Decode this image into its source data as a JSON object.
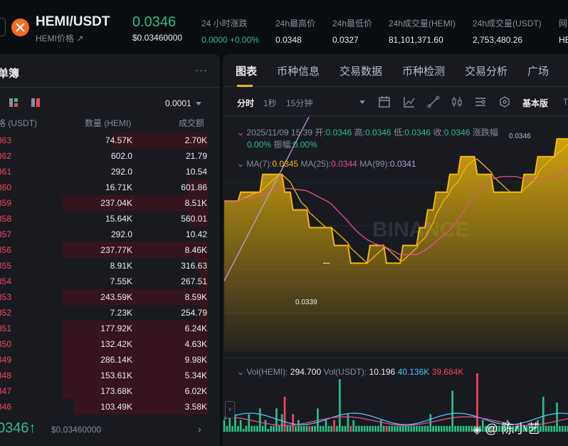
{
  "header": {
    "pair": "HEMI/USDT",
    "pair_sub": "HEMI价格 ↗",
    "last_price": "0.0346",
    "last_price_usd": "$0.03460000",
    "stats": [
      {
        "label": "24 小时涨跌",
        "value": "0.0000 +0.00%",
        "color": "green"
      },
      {
        "label": "24h最高价",
        "value": "0.0348"
      },
      {
        "label": "24h最低价",
        "value": "0.0327"
      },
      {
        "label": "24h成交量(HEMI)",
        "value": "81,101,371.60"
      },
      {
        "label": "24h成交量(USDT)",
        "value": "2,753,480.26"
      },
      {
        "label": "网",
        "value": "HE"
      }
    ]
  },
  "orderbook": {
    "title": "单簿",
    "more": "···",
    "precision": "0.0001",
    "col_price": "格 (USDT)",
    "col_qty": "数量 (HEMI)",
    "col_total": "成交额",
    "asks": [
      {
        "price": "363",
        "qty": "74.57K",
        "total": "2.70K",
        "depth": 0.66
      },
      {
        "price": "362",
        "qty": "602.0",
        "total": "21.79",
        "depth": 0
      },
      {
        "price": "361",
        "qty": "292.0",
        "total": "10.54",
        "depth": 0
      },
      {
        "price": "360",
        "qty": "16.71K",
        "total": "601.86",
        "depth": 0.14
      },
      {
        "price": "359",
        "qty": "237.04K",
        "total": "8.51K",
        "depth": 1.0
      },
      {
        "price": "358",
        "qty": "15.64K",
        "total": "560.01",
        "depth": 0.13
      },
      {
        "price": "357",
        "qty": "292.0",
        "total": "10.42",
        "depth": 0
      },
      {
        "price": "356",
        "qty": "237.77K",
        "total": "8.46K",
        "depth": 1.0
      },
      {
        "price": "355",
        "qty": "8.91K",
        "total": "316.63",
        "depth": 0.07
      },
      {
        "price": "354",
        "qty": "7.55K",
        "total": "267.51",
        "depth": 0.06
      },
      {
        "price": "353",
        "qty": "243.59K",
        "total": "8.59K",
        "depth": 1.0
      },
      {
        "price": "352",
        "qty": "7.23K",
        "total": "254.79",
        "depth": 0.06
      },
      {
        "price": "351",
        "qty": "177.92K",
        "total": "6.24K",
        "depth": 1.0
      },
      {
        "price": "350",
        "qty": "132.42K",
        "total": "4.63K",
        "depth": 1.0
      },
      {
        "price": "349",
        "qty": "286.14K",
        "total": "9.98K",
        "depth": 1.0
      },
      {
        "price": "348",
        "qty": "153.61K",
        "total": "5.34K",
        "depth": 1.0
      },
      {
        "price": "347",
        "qty": "173.68K",
        "total": "6.02K",
        "depth": 1.0
      },
      {
        "price": "346",
        "qty": "103.49K",
        "total": "3.58K",
        "depth": 0.92
      }
    ],
    "last_price": "0346↑",
    "last_price_usd": "$0.03460000",
    "chevron": "›"
  },
  "tabs": [
    "图表",
    "币种信息",
    "交易数据",
    "币种检测",
    "交易分析",
    "广场"
  ],
  "toolbar": {
    "intervals": [
      "分时",
      "1秒",
      "15分钟"
    ],
    "version": "基本版",
    "cut": "T"
  },
  "chart_info": {
    "ohlc_prefix": "2025/11/09 15:39",
    "open_label": "开:",
    "open": "0.0346",
    "high_label": "高:",
    "high": "0.0346",
    "low_label": "低:",
    "low": "0.0346",
    "close_label": "收:",
    "close": "0.0346",
    "change_label": "涨跌幅",
    "change": "0.00%",
    "amp_label": "振幅:",
    "amp": "0.00%",
    "ma7_label": "MA(7):",
    "ma7": "0.0345",
    "ma25_label": "MA(25):",
    "ma25": "0.0344",
    "ma99_label": "MA(99):",
    "ma99": "0.0341",
    "price_high_label": "0.0346",
    "price_low_label": "0.0339",
    "vol_hemi_label": "Vol(HEMI):",
    "vol_hemi": "294.700",
    "vol_usdt_label": "Vol(USDT):",
    "vol_usdt": "10.196",
    "vol_ma1": "40.136K",
    "vol_ma2": "39.684K",
    "watermark_brand": "BINANCE",
    "colors": {
      "up": "#2ebd85",
      "down": "#f6465d",
      "area": "#f0b90b",
      "ma25": "#e2528c",
      "ma99": "#b39ddb"
    }
  },
  "chart_data": {
    "type": "area",
    "series": [
      {
        "values": [
          0.03425,
          0.03425,
          0.03425,
          0.03425,
          0.03425,
          0.03425,
          0.0343,
          0.0343,
          0.0343,
          0.0343,
          0.0343,
          0.0343,
          0.0343,
          0.0343,
          0.0344,
          0.0344,
          0.0344,
          0.0344,
          0.0344,
          0.0344,
          0.0344,
          0.0344,
          0.0343,
          0.0343,
          0.0343,
          0.0342,
          0.0342,
          0.0342,
          0.0342,
          0.0342,
          0.0342,
          0.0341,
          0.0341,
          0.0341,
          0.0341,
          0.0341,
          0.0341,
          0.0341,
          0.0341,
          0.0341,
          0.034,
          0.034,
          0.034,
          0.034,
          0.034,
          0.034,
          0.0339,
          0.0339,
          0.0339,
          0.0339,
          0.0339,
          0.0339,
          0.0339,
          0.034,
          0.034,
          0.034,
          0.034,
          0.034,
          0.034,
          0.0339,
          0.0339,
          0.0339,
          0.0339,
          0.0339,
          0.0339,
          0.034,
          0.034,
          0.034,
          0.034,
          0.034,
          0.034,
          0.0341,
          0.0341,
          0.0341,
          0.0342,
          0.0342,
          0.0342,
          0.0343,
          0.0343,
          0.0343,
          0.0343,
          0.0343,
          0.0344,
          0.0344,
          0.0344,
          0.0344,
          0.0345,
          0.0345,
          0.0345,
          0.0345,
          0.0345,
          0.0345,
          0.0344,
          0.0344,
          0.0344,
          0.0344,
          0.0344,
          0.0344,
          0.0343,
          0.0343,
          0.0343,
          0.0343,
          0.0343,
          0.0343,
          0.0343,
          0.0343,
          0.0343,
          0.0343,
          0.0343,
          0.0344,
          0.0344,
          0.0344,
          0.0344,
          0.0344,
          0.0345,
          0.0345,
          0.0345,
          0.0345,
          0.0345,
          0.0345,
          0.0345,
          0.0346,
          0.0346,
          0.0346,
          0.0346,
          0.0346
        ]
      }
    ],
    "ylim": [
      0.0334,
      0.0347
    ]
  }
}
